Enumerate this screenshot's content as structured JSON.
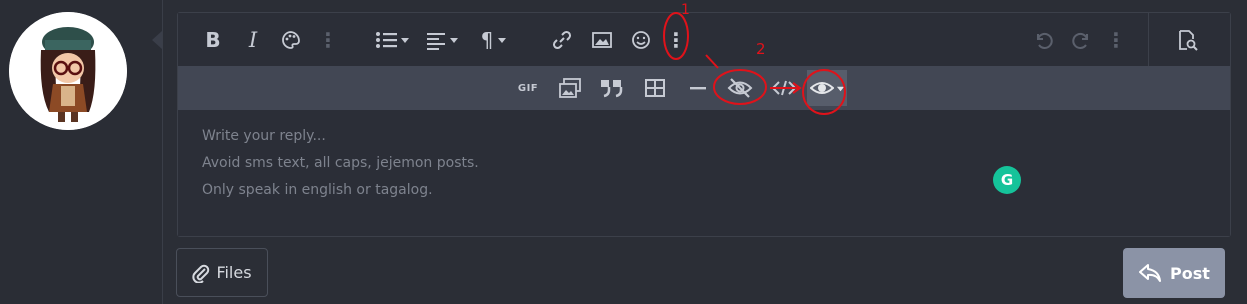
{
  "editor": {
    "toolbar_main": [
      {
        "name": "bold",
        "glyph": "B"
      },
      {
        "name": "italic",
        "glyph": "I"
      },
      {
        "name": "text-color",
        "glyph": ""
      },
      {
        "name": "more-vertical",
        "glyph": "⋮"
      },
      {
        "name": "list",
        "glyph": ""
      },
      {
        "name": "align",
        "glyph": ""
      },
      {
        "name": "paragraph",
        "glyph": "¶"
      },
      {
        "name": "link",
        "glyph": ""
      },
      {
        "name": "image",
        "glyph": ""
      },
      {
        "name": "emoji",
        "glyph": ""
      },
      {
        "name": "more-vertical",
        "glyph": "⋮"
      }
    ],
    "toolbar_secondary": {
      "gif_label": "GIF"
    },
    "placeholder_lines": [
      "Write your reply...",
      "Avoid sms text, all caps, jejemon posts.",
      "Only speak in english or tagalog."
    ]
  },
  "actions": {
    "files_label": "Files",
    "post_label": "Post"
  },
  "colors": {
    "page_bg": "#2b2e36",
    "toolbar_secondary_bg": "#424754",
    "post_button_bg": "#8b93a6",
    "grammarly_green": "#15c39a",
    "annotation_red": "#e0121a"
  },
  "annotations": {
    "mark_1": "1",
    "mark_2": "2"
  },
  "grammarly": {
    "glyph": "G"
  }
}
